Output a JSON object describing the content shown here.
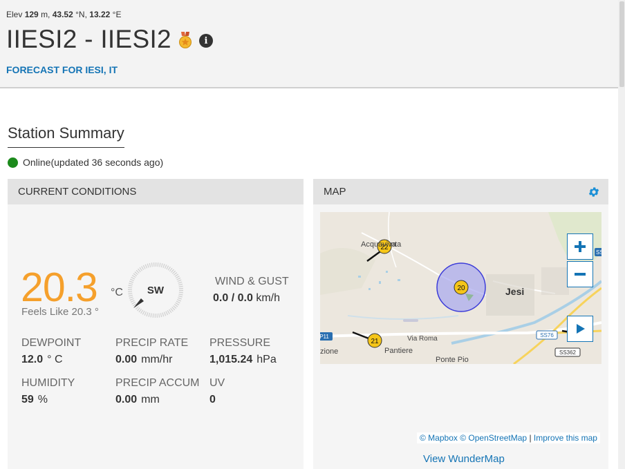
{
  "header": {
    "elev_prefix": "Elev",
    "elev_value": "129",
    "elev_unit": "m,",
    "lat_value": "43.52",
    "lat_unit": "°N,",
    "lon_value": "13.22",
    "lon_unit": "°E",
    "title": "IIESI2 - IIESI2",
    "forecast_link": "FORECAST FOR IESI, IT"
  },
  "summary": {
    "title": "Station Summary",
    "status": "Online(updated 36 seconds ago)",
    "status_color": "#1c8a1c"
  },
  "current_conditions": {
    "header": "CURRENT CONDITIONS",
    "temperature": "20.3",
    "temp_unit": "°C",
    "feels_like": "Feels Like 20.3 °",
    "wind_direction": "SW",
    "wind_label": "WIND & GUST",
    "wind_speed": "0.0",
    "wind_sep": "/",
    "wind_gust": "0.0",
    "wind_unit": "km/h",
    "dewpoint_label": "DEWPOINT",
    "dewpoint_value": "12.0",
    "dewpoint_unit": "° C",
    "precip_rate_label": "PRECIP RATE",
    "precip_rate_value": "0.00",
    "precip_rate_unit": "mm/hr",
    "pressure_label": "PRESSURE",
    "pressure_value": "1,015.24",
    "pressure_unit": "hPa",
    "humidity_label": "HUMIDITY",
    "humidity_value": "59",
    "humidity_unit": "%",
    "precip_accum_label": "PRECIP ACCUM",
    "precip_accum_value": "0.00",
    "precip_accum_unit": "mm",
    "uv_label": "UV",
    "uv_value": "0",
    "accent_color": "#f5a02c"
  },
  "map": {
    "header": "MAP",
    "labels": {
      "town1": "Acquaviva",
      "town1_tail": "nta",
      "jesi": "Jesi",
      "via_roma": "Via Roma",
      "pantiere": "Pantiere",
      "ponte_pio": "Ponte Pio",
      "zione": "zione",
      "road_ss76": "SS76",
      "road_ss362": "SS362",
      "road_p11": "P11",
      "road_ss_edge": "SS"
    },
    "markers": [
      {
        "label": "22"
      },
      {
        "label": "20"
      },
      {
        "label": "21"
      }
    ],
    "zoom_in": "+",
    "zoom_out": "−",
    "attrib_mapbox": "© Mapbox",
    "attrib_osm": "© OpenStreetMap",
    "attrib_sep": "|",
    "attrib_improve": "Improve this map",
    "view_link": "View WunderMap"
  },
  "colors": {
    "link": "#1474b5",
    "panel_header": "#e3e3e3",
    "marker": "#f5c518"
  }
}
